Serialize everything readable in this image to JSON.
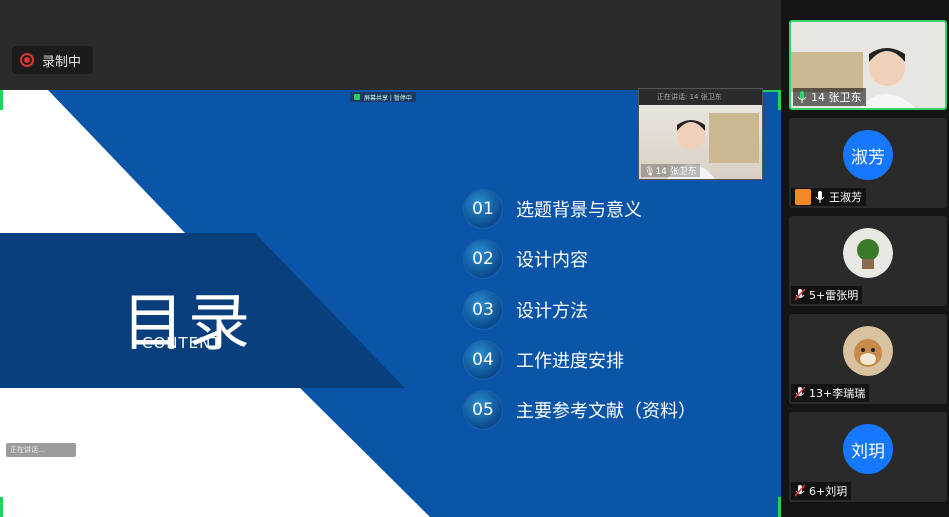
{
  "recording": {
    "label": "录制中"
  },
  "slide": {
    "title": "目录",
    "subtitle": "CONTENT",
    "share_tag": "屏幕共享  |  暂停中",
    "items": [
      {
        "num": "01",
        "text": "选题背景与意义"
      },
      {
        "num": "02",
        "text": "设计内容"
      },
      {
        "num": "03",
        "text": "设计方法"
      },
      {
        "num": "04",
        "text": "工作进度安排"
      },
      {
        "num": "05",
        "text": "主要参考文献（资料）"
      }
    ],
    "left_chip": "正在讲话…"
  },
  "pip": {
    "header": "正在讲话: 14 张卫东",
    "name": "14 张卫东"
  },
  "participants": [
    {
      "name": "14 张卫东",
      "type": "video",
      "active": true,
      "muted": false
    },
    {
      "name": "王淑芳",
      "type": "initials",
      "initials": "淑芳",
      "color": "#1677ff",
      "host": true,
      "muted": false
    },
    {
      "name": "5+雷张明",
      "type": "image",
      "muted": true
    },
    {
      "name": "13+李瑞瑞",
      "type": "image",
      "muted": true
    },
    {
      "name": "6+刘玥",
      "type": "initials",
      "initials": "刘玥",
      "color": "#1677ff",
      "muted": true
    }
  ],
  "colors": {
    "accent_green": "#2fd36a",
    "slide_blue": "#0b55a8",
    "avatar_blue": "#1677ff",
    "record_red": "#dd3333"
  }
}
